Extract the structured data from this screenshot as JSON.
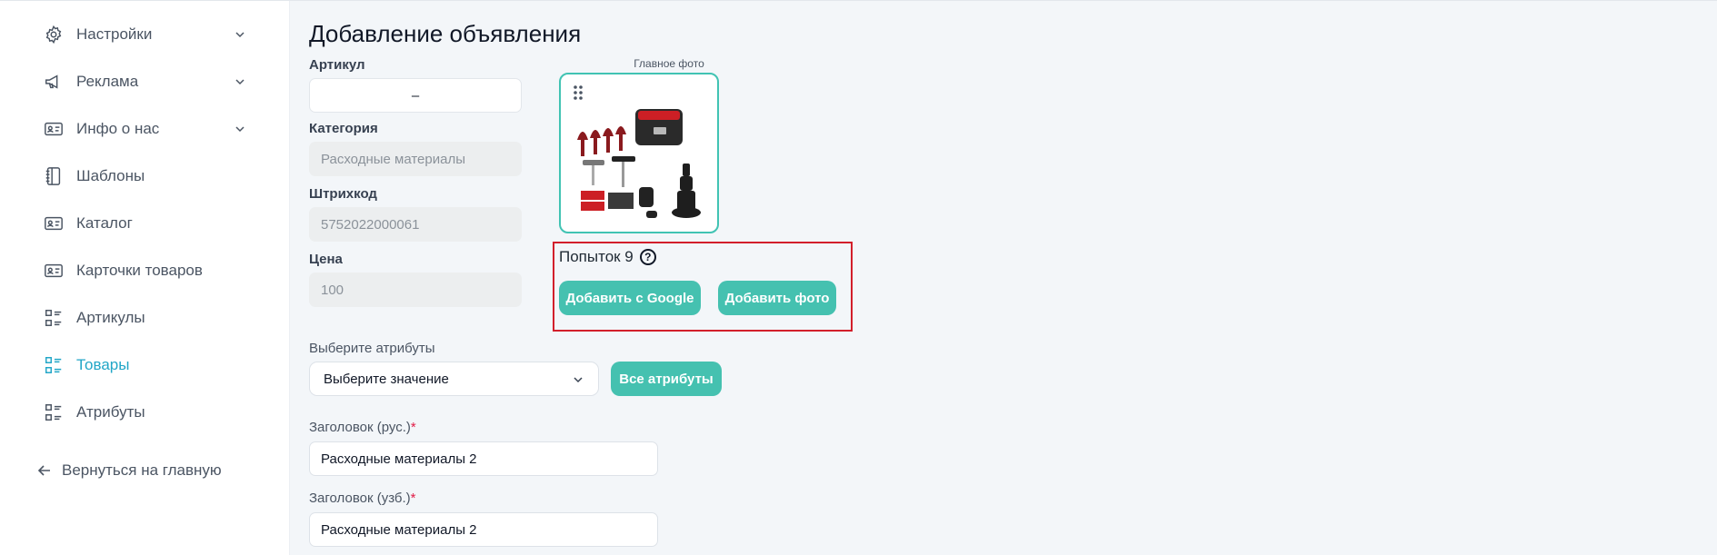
{
  "sidebar": {
    "items": [
      {
        "label": "Настройки",
        "icon": "gear-icon",
        "expandable": true
      },
      {
        "label": "Реклама",
        "icon": "megaphone-icon",
        "expandable": true
      },
      {
        "label": "Инфо о нас",
        "icon": "id-card-icon",
        "expandable": true
      },
      {
        "label": "Шаблоны",
        "icon": "notebook-icon",
        "expandable": false
      },
      {
        "label": "Каталог",
        "icon": "id-card-icon",
        "expandable": false
      },
      {
        "label": "Карточки товаров",
        "icon": "id-card-icon",
        "expandable": false
      },
      {
        "label": "Артикулы",
        "icon": "list-icon",
        "expandable": false
      },
      {
        "label": "Товары",
        "icon": "list-icon",
        "expandable": false,
        "active": true
      },
      {
        "label": "Атрибуты",
        "icon": "list-icon",
        "expandable": false
      }
    ],
    "back_label": "Вернуться на главную"
  },
  "main": {
    "title": "Добавление объявления",
    "article": {
      "label": "Артикул",
      "value": "–"
    },
    "category": {
      "label": "Категория",
      "value": "Расходные материалы"
    },
    "barcode": {
      "label": "Штрихкод",
      "value": "5752022000061"
    },
    "price": {
      "label": "Цена",
      "value": "100"
    },
    "photo": {
      "caption": "Главное фото",
      "attempts_label": "Попыток 9",
      "help_symbol": "?",
      "add_google_label": "Добавить с Google",
      "add_photo_label": "Добавить фото"
    },
    "attributes": {
      "label": "Выберите атрибуты",
      "select_value": "Выберите значение",
      "all_label": "Все атрибуты"
    },
    "title_ru": {
      "label": "Заголовок (рус.)",
      "required_mark": "*",
      "value": "Расходные материалы 2"
    },
    "title_uz": {
      "label": "Заголовок (узб.)",
      "required_mark": "*",
      "value": "Расходные материалы 2"
    }
  },
  "colors": {
    "accent": "#21a6c7",
    "button": "#45c1b0",
    "photo_border": "#41c3b3",
    "highlight": "#d21f2b",
    "required": "#e11d48"
  }
}
